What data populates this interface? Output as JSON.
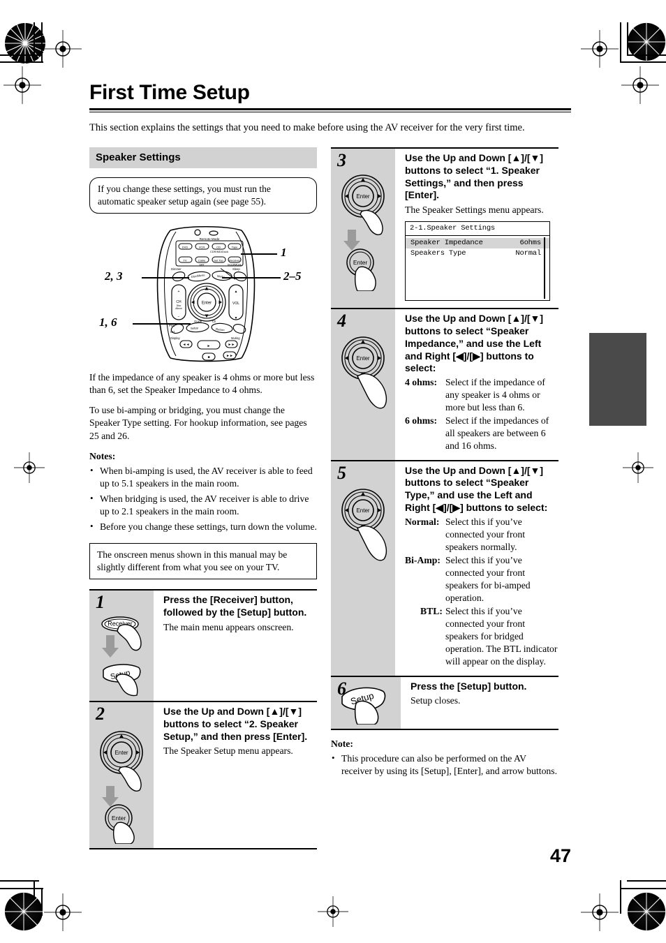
{
  "document": {
    "title": "First Time Setup",
    "intro": "This section explains the settings that you need to make before using the AV receiver for the very first time.",
    "page_number": "47"
  },
  "left_column": {
    "section_header": "Speaker Settings",
    "round_note": "If you change these settings, you must run the automatic speaker setup again (see page 55).",
    "remote_callouts": [
      {
        "label": "1"
      },
      {
        "label": "2, 3"
      },
      {
        "label": "2–5"
      },
      {
        "label": "1, 6"
      }
    ],
    "paragraph_1": "If the impedance of any speaker is 4 ohms or more but less than 6, set the Speaker Impedance to 4 ohms.",
    "paragraph_2": "To use bi-amping or bridging, you must change the Speaker Type setting. For hookup information, see pages 25 and 26.",
    "notes_heading": "Notes:",
    "notes": [
      "When bi-amping is used, the AV receiver is able to feed up to 5.1 speakers in the main room.",
      "When bridging is used, the AV receiver is able to drive up to 2.1 speakers in the main room.",
      "Before you change these settings, turn down the volume."
    ],
    "square_note": "The onscreen menus shown in this manual may be slightly different  from what you see on your TV.",
    "steps": [
      {
        "number": "1",
        "title": "Press the [Receiver] button, followed by the [Setup] button.",
        "sub": "The main menu appears onscreen.",
        "buttons": [
          "Receiver",
          "Setup"
        ]
      },
      {
        "number": "2",
        "title": "Use the Up and Down [▲]/[▼] buttons to select “2. Speaker Setup,” and then press [Enter].",
        "sub": "The Speaker Setup menu appears.",
        "buttons": [
          "Enter",
          "Enter"
        ]
      }
    ]
  },
  "right_column": {
    "steps": [
      {
        "number": "3",
        "title": "Use the Up and Down [▲]/[▼] buttons to select “1. Speaker Settings,” and then press [Enter].",
        "sub": "The Speaker Settings menu appears.",
        "buttons": [
          "Enter",
          "Enter"
        ],
        "osd": {
          "title": "2-1.Speaker Settings",
          "rows": [
            {
              "label": "Speaker Impedance",
              "value": "6ohms",
              "selected": true
            },
            {
              "label": "Speakers Type",
              "value": "Normal",
              "selected": false
            }
          ]
        }
      },
      {
        "number": "4",
        "title": "Use the Up and Down [▲]/[▼] buttons to select “Speaker Impedance,” and use the Left and Right [◀]/[▶] buttons to select:",
        "buttons": [
          "Enter"
        ],
        "definitions": [
          {
            "term": "4 ohms:",
            "desc": "Select if the impedance of any speaker is 4 ohms or more but less than 6."
          },
          {
            "term": "6 ohms:",
            "desc": "Select if the impedances of all speakers are between 6 and 16 ohms."
          }
        ]
      },
      {
        "number": "5",
        "title": "Use the Up and Down [▲]/[▼] buttons to select “Speaker Type,” and use the Left and Right [◀]/[▶] buttons to select:",
        "buttons": [
          "Enter"
        ],
        "definitions": [
          {
            "term": "Normal:",
            "desc": "Select this if you’ve connected your front speakers normally."
          },
          {
            "term": "Bi-Amp:",
            "desc": "Select this if you’ve connected your front speakers for bi-amped operation."
          },
          {
            "term": "BTL:",
            "desc": "Select this if you’ve connected your front speakers for bridged operation. The BTL indicator will appear on the display."
          }
        ]
      },
      {
        "number": "6",
        "title": "Press the [Setup] button.",
        "sub": "Setup closes.",
        "buttons": [
          "Setup"
        ]
      }
    ],
    "tail_note_heading": "Note:",
    "tail_note": "This procedure can also be performed on the AV receiver by using its [Setup], [Enter], and arrow buttons."
  },
  "colors": {
    "section_bar": "#d2d2d2",
    "step_num_bg": "#d2d2d2",
    "right_tab": "#4a4a4a",
    "osd_selected_row": "#d5d5d5"
  }
}
